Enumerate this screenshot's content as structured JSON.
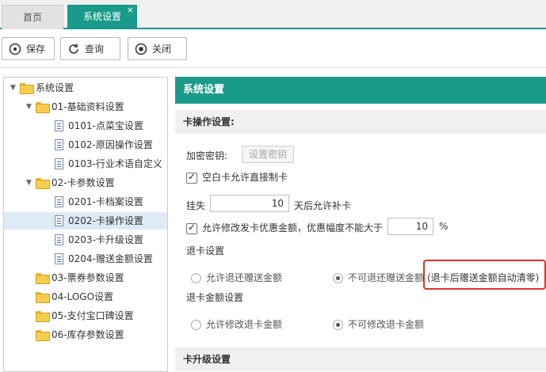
{
  "tabs": {
    "home": "首页",
    "active": "系统设置",
    "close": "×"
  },
  "toolbar": {
    "save": "保存",
    "query": "查询",
    "close": "关闭"
  },
  "tree": {
    "root": "系统设置",
    "g1": "01-基础资料设置",
    "g1_items": [
      "0101-点菜宝设置",
      "0102-原因操作设置",
      "0103-行业术语自定义"
    ],
    "g2": "02-卡参数设置",
    "g2_items": [
      "0201-卡档案设置",
      "0202-卡操作设置",
      "0203-卡升级设置",
      "0204-赠送金额设置"
    ],
    "g3": "03-票券参数设置",
    "g4": "04-LOGO设置",
    "g5": "05-支付宝口碑设置",
    "g6": "06-库存参数设置"
  },
  "content": {
    "title": "系统设置",
    "section1": "卡操作设置:",
    "encrypt_label": "加密密钥:",
    "encrypt_btn": "设置密钥",
    "blank_card": "空白卡允许直接制卡",
    "loss_prefix": "挂失",
    "loss_days": "10",
    "loss_suffix": "天后允许补卡",
    "discount_label": "允许修改发卡优惠金额，优惠幅度不能大于",
    "discount_value": "10",
    "discount_unit": "%",
    "refund_title": "退卡设置",
    "refund_opt1": "允许退还赠送金额",
    "refund_opt2": "不可退还赠送金额",
    "refund_note": "(退卡后赠送金额自动清零)",
    "refund_amount_title": "退卡金额设置",
    "amount_opt1": "允许修改退卡金额",
    "amount_opt2": "不可修改退卡金额",
    "section2": "卡升级设置"
  },
  "colors": {
    "accent": "#1a9a8a",
    "highlight": "#e0302a",
    "selected": "#dfeaf7"
  }
}
